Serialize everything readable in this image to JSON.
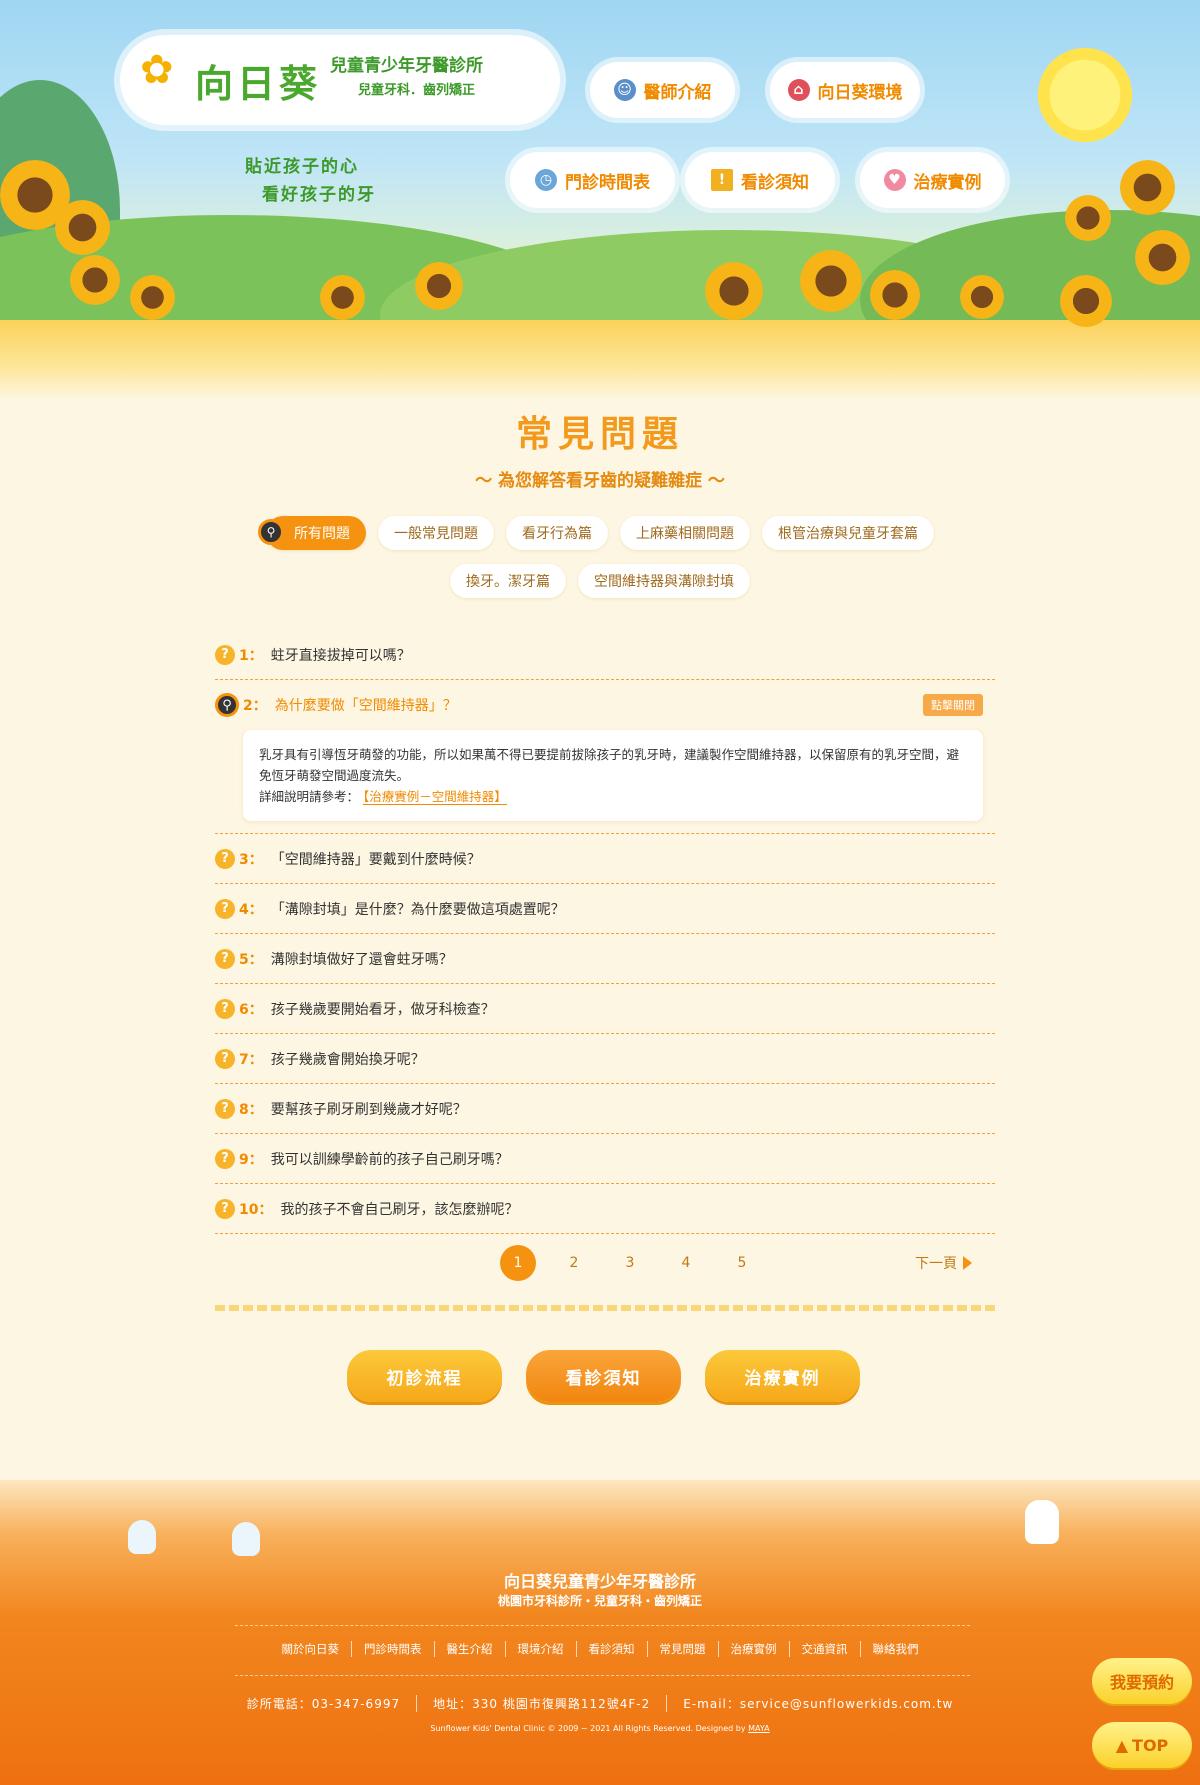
{
  "header": {
    "logo_title": "向日葵",
    "logo_sub1": "兒童青少年牙醫診所",
    "logo_sub2": "兒童牙科．齒列矯正",
    "slogan_line1": "貼近孩子的心",
    "slogan_line2": "看好孩子的牙",
    "nav": [
      {
        "label": "醫師介紹"
      },
      {
        "label": "向日葵環境"
      },
      {
        "label": "門診時間表"
      },
      {
        "label": "看診須知"
      },
      {
        "label": "治療實例"
      }
    ]
  },
  "main": {
    "title": "常見問題",
    "subtitle": "～ 為您解答看牙齒的疑難雜症 ～",
    "tabs_row1": [
      "所有問題",
      "一般常見問題",
      "看牙行為篇",
      "上麻藥相關問題",
      "根管治療與兒童牙套篇"
    ],
    "tabs_row2": [
      "換牙。潔牙篇",
      "空間維持器與溝隙封填"
    ],
    "faq": [
      {
        "num": "1：",
        "q": "蛀牙直接拔掉可以嗎？"
      },
      {
        "num": "2：",
        "q": "為什麼要做「空間維持器」？",
        "close": "點擊關閉",
        "answer": "乳牙具有引導恆牙萌發的功能，所以如果萬不得已要提前拔除孩子的乳牙時，建議製作空間維持器，以保留原有的乳牙空間，避免恆牙萌發空間過度流失。",
        "ref_label": "詳細說明請參考：",
        "ref_link": "【治療實例－空間維持器】"
      },
      {
        "num": "3：",
        "q": "「空間維持器」要戴到什麼時候？"
      },
      {
        "num": "4：",
        "q": "「溝隙封填」是什麼？為什麼要做這項處置呢？"
      },
      {
        "num": "5：",
        "q": "溝隙封填做好了還會蛀牙嗎？"
      },
      {
        "num": "6：",
        "q": "孩子幾歲要開始看牙，做牙科檢查？"
      },
      {
        "num": "7：",
        "q": "孩子幾歲會開始換牙呢？"
      },
      {
        "num": "8：",
        "q": "要幫孩子刷牙刷到幾歲才好呢？"
      },
      {
        "num": "9：",
        "q": "我可以訓練學齡前的孩子自己刷牙嗎？"
      },
      {
        "num": "10：",
        "q": "我的孩子不會自己刷牙，該怎麼辦呢？"
      }
    ],
    "pagination": {
      "pages": [
        "1",
        "2",
        "3",
        "4",
        "5"
      ],
      "current": "1",
      "next": "下一頁"
    },
    "bottom_buttons": [
      "初診流程",
      "看診須知",
      "治療實例"
    ]
  },
  "footer": {
    "title": "向日葵兒童青少年牙醫診所",
    "subtitle": "桃園市牙科診所・兒童牙科・齒列矯正",
    "links": [
      "關於向日葵",
      "門診時間表",
      "醫生介紹",
      "環境介紹",
      "看診須知",
      "常見問題",
      "治療實例",
      "交通資訊",
      "聯絡我們"
    ],
    "phone": "診所電話：03-347-6997",
    "address": "地址：330 桃園市復興路112號4F-2",
    "email": "E-mail：service@sunflowerkids.com.tw",
    "copyright": "Sunflower Kids' Dental Clinic © 2009 ~ 2021 All Rights Reserved. Designed by",
    "designer": "MAYA"
  },
  "floating": {
    "reserve": "我要預約",
    "top": "TOP"
  },
  "colors": {
    "accent": "#f59210",
    "green": "#4aa82e",
    "footer": "#ee7010"
  }
}
